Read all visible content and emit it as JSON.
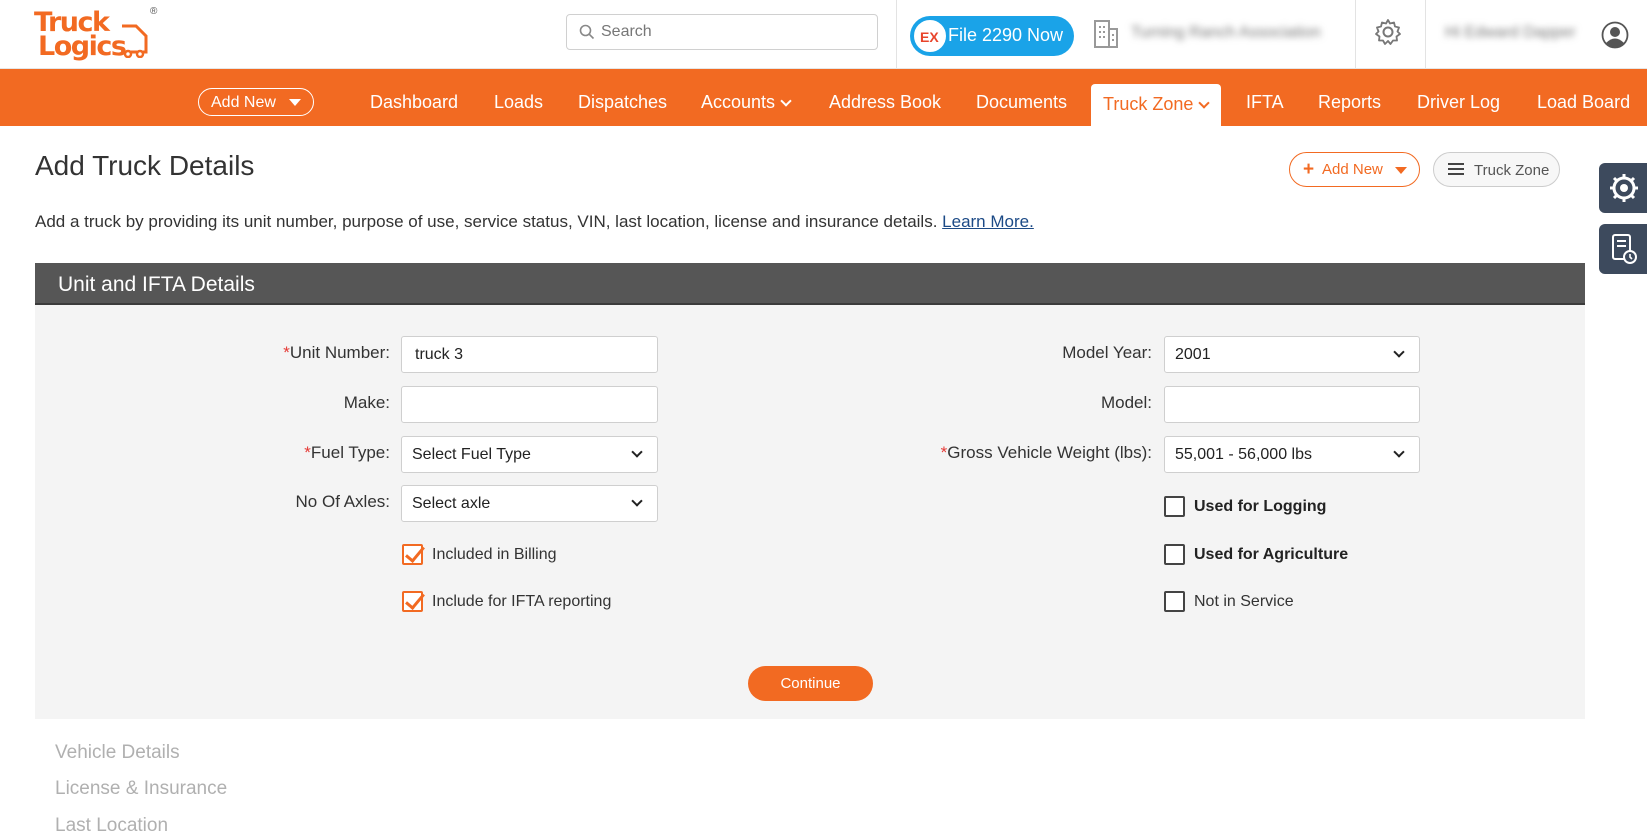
{
  "brand": {
    "line1": "Truck",
    "line2": "Logics",
    "registered": "®",
    "accent": "#f26a22"
  },
  "search": {
    "placeholder": "Search"
  },
  "file_button": {
    "badge": "EX",
    "label": "File 2290 Now"
  },
  "org_name": "Turning Ranch Association",
  "user_name": "Hi Edward Dapper",
  "nav": {
    "add_new": "Add New",
    "items": [
      "Dashboard",
      "Loads",
      "Dispatches",
      "Accounts",
      "Address Book",
      "Documents",
      "Truck Zone",
      "IFTA",
      "Reports",
      "Driver Log",
      "Load Board"
    ],
    "active": "Truck Zone"
  },
  "page": {
    "title": "Add Truck Details",
    "add_new": "Add New",
    "truck_zone": "Truck Zone",
    "description": "Add a truck by providing its unit number, purpose of use, service status, VIN, last location, license and insurance details.",
    "learn_more": "Learn More."
  },
  "section": {
    "title": "Unit and IFTA Details",
    "unit_number": {
      "label": "Unit Number:",
      "value": "truck 3",
      "required": "*"
    },
    "make": {
      "label": "Make:",
      "value": ""
    },
    "fuel_type": {
      "label": "Fuel Type:",
      "value": "Select Fuel Type",
      "required": "*"
    },
    "axles": {
      "label": "No Of Axles:",
      "value": "Select axle"
    },
    "model_year": {
      "label": "Model Year:",
      "value": "2001"
    },
    "model": {
      "label": "Model:",
      "value": ""
    },
    "gvw": {
      "label": "Gross Vehicle Weight (lbs):",
      "value": "55,001 - 56,000 lbs",
      "required": "*"
    },
    "checkboxes": {
      "billing": {
        "label": "Included in Billing",
        "checked": true
      },
      "ifta": {
        "label": "Include for IFTA reporting",
        "checked": true
      },
      "logging": {
        "label": "Used for Logging",
        "checked": false
      },
      "agriculture": {
        "label": "Used for Agriculture",
        "checked": false
      },
      "not_in_service": {
        "label": "Not in Service",
        "checked": false
      }
    },
    "continue": "Continue"
  },
  "subsections": [
    "Vehicle Details",
    "License & Insurance",
    "Last Location"
  ]
}
